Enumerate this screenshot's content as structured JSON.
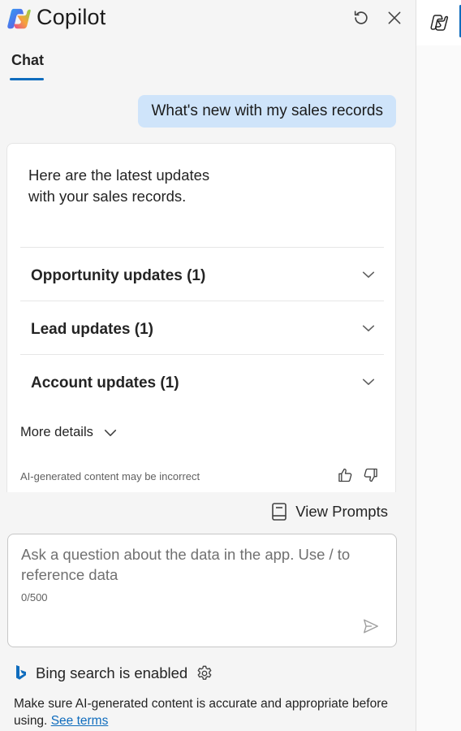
{
  "header": {
    "title": "Copilot",
    "icons": [
      "copilot-logo",
      "refresh-icon",
      "close-icon"
    ]
  },
  "tabs": [
    {
      "label": "Chat",
      "active": true
    }
  ],
  "conversation": {
    "user_message": "What's new with my sales records",
    "response": {
      "intro": "Here are the latest updates with your sales records.",
      "sections": [
        {
          "label": "Opportunity updates (1)"
        },
        {
          "label": "Lead updates (1)"
        },
        {
          "label": "Account updates (1)"
        }
      ],
      "more_details": "More details",
      "disclaimer": "AI-generated content may be incorrect"
    }
  },
  "prompts": {
    "label": "View Prompts"
  },
  "input": {
    "placeholder": "Ask a question about the data in the app. Use / to reference data",
    "counter": "0/500"
  },
  "bing": {
    "label": "Bing search is enabled"
  },
  "footer": {
    "note": "Make sure AI-generated content is accurate and appropriate before using.",
    "link": "See terms"
  },
  "colors": {
    "accent": "#0f6cbd",
    "user_bubble": "#cfe4fa",
    "panel_bg": "#f5f5f5"
  }
}
